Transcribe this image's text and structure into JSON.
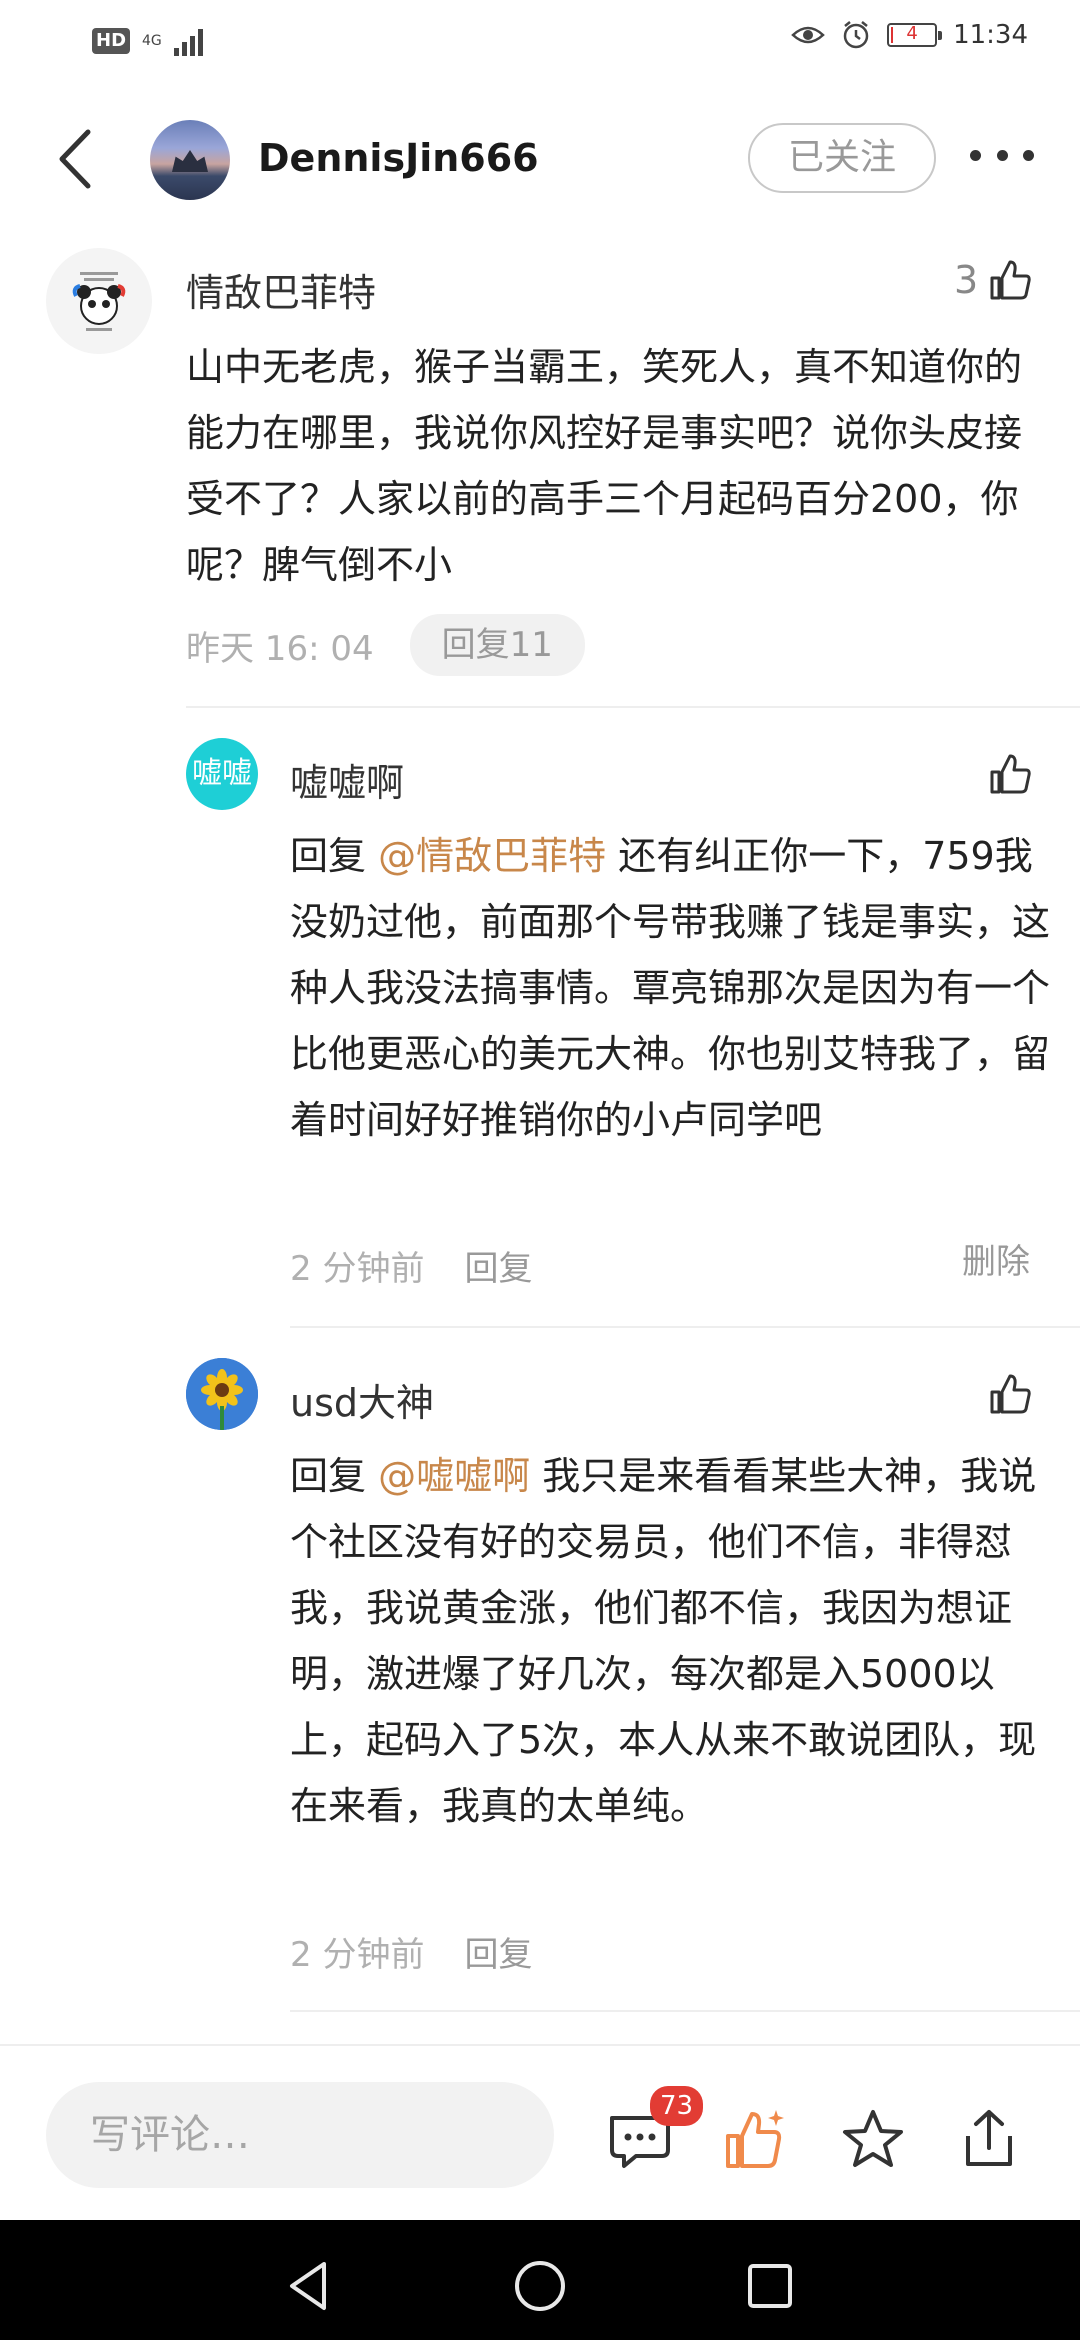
{
  "status_bar": {
    "hd": "HD",
    "network": "4G",
    "battery_level": "4",
    "battery_fraction": 0.04,
    "time": "11:34"
  },
  "header": {
    "username": "DennisJin666",
    "follow_label": "已关注"
  },
  "main_comment": {
    "author": "情敌巴菲特",
    "like_count": "3",
    "text": "山中无老虎，猴子当霸王，笑死人，真不知道你的能力在哪里，我说你风控好是事实吧？说你头皮接受不了？人家以前的高手三个月起码百分200，你呢？脾气倒不小",
    "time": "昨天 16: 04",
    "reply_count_label": "回复11"
  },
  "replies": [
    {
      "author": "嘘嘘啊",
      "avatar_text": "嘘嘘",
      "prefix": "回复 ",
      "mention": "@情敌巴菲特",
      "text": " 还有纠正你一下，759我没奶过他，前面那个号带我赚了钱是事实，这种人我没法搞事情。覃亮锦那次是因为有一个比他更恶心的美元大神。你也别艾特我了，留着时间好好推销你的小卢同学吧",
      "time": "2 分钟前",
      "reply_label": "回复",
      "delete_label": "删除"
    },
    {
      "author": "usd大神",
      "prefix": "回复 ",
      "mention": "@嘘嘘啊",
      "text": " 我只是来看看某些大神，我说个社区没有好的交易员，他们不信，非得怼我，我说黄金涨，他们都不信，我因为想证明，激进爆了好几次，每次都是入5000以上，起码入了5次，本人从来不敢说团队，现在来看，我真的太单纯。",
      "time": "2 分钟前",
      "reply_label": "回复"
    }
  ],
  "bottom_bar": {
    "comment_placeholder": "写评论…",
    "comment_count_badge": "73",
    "icons": [
      "comment-icon",
      "like-icon",
      "star-icon",
      "share-icon"
    ],
    "accent_color": "#f08a4b"
  },
  "nav_bar": {
    "icons": [
      "back-triangle-icon",
      "home-circle-icon",
      "recents-square-icon"
    ]
  }
}
